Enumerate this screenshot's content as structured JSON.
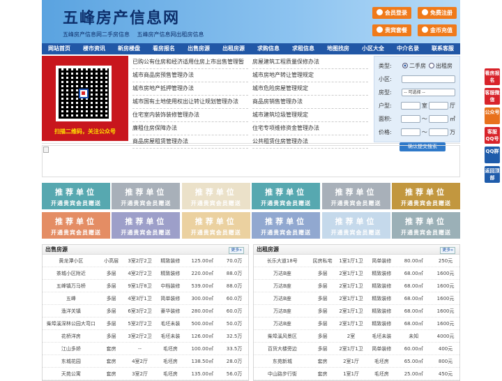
{
  "header": {
    "title": "五峰房产信息网",
    "links": [
      "五峰房产信息网二手房信息",
      "五峰房产信息网出租房信息"
    ],
    "buttons": [
      "会员登录",
      "免费注册",
      "贵宾套餐",
      "金币充值"
    ]
  },
  "nav": [
    "网站首页",
    "楼市资讯",
    "新房楼盘",
    "看房报名",
    "出售房源",
    "出租房源",
    "求购信息",
    "求租信息",
    "地图找房",
    "小区大全",
    "中介名录",
    "联系客服"
  ],
  "qr": {
    "caption": "扫描二维码，关注公众号"
  },
  "news": {
    "left": [
      "已购公有住房和经济适用住房上市出售管理暂",
      "城市商品房预售管理办法",
      "城市房地产抵押管理办法",
      "城市国有土地使用权出让转让规划管理办法",
      "住宅室内装饰装修管理办法",
      "廉租住房保障办法",
      "商品房屋租赁管理办法"
    ],
    "right": [
      "房屋建筑工程质量保修办法",
      "城市房地产转让管理规定",
      "城市危险房屋管理规定",
      "商品房销售管理办法",
      "城市建筑垃圾管理规定",
      "住宅专项维修资金管理办法",
      "公共租赁住房管理办法"
    ]
  },
  "search": {
    "type_label": "类型:",
    "opt1": "二手房",
    "opt2": "出租房",
    "community_label": "小区:",
    "house_label": "房型:",
    "house_value": "-- 可选择 --",
    "room_label": "户型:",
    "room_unit": "室",
    "hall_unit": "厅",
    "area_label": "面积:",
    "area_sep": "～",
    "area_unit": "㎡",
    "price_label": "价格:",
    "price_sep": "～",
    "price_unit": "万",
    "submit": "确认提交搜索"
  },
  "promo": {
    "t1": "推荐单位",
    "t2": "开通贵宾会员赠送",
    "colors": [
      "#3a9aa3",
      "#9aa3ad",
      "#e8dcc0",
      "#3a9aa3",
      "#9aa3ad",
      "#b8861e",
      "#e07a4a",
      "#8c8fc0",
      "#e8c990",
      "#7e99c8",
      "#bcd3e8",
      "#8aa3ab"
    ]
  },
  "sale": {
    "title": "出售房源",
    "more": "更多»",
    "rows": [
      [
        "黄龙潭小区",
        "小高层",
        "3室2厅2卫",
        "精致装修",
        "125.00㎡",
        "70.0万"
      ],
      [
        "茶城小区附近",
        "多层",
        "4室2厅2卫",
        "精致装修",
        "220.00㎡",
        "88.0万"
      ],
      [
        "五峰镇万马桥",
        "多层",
        "9室1厅8卫",
        "中档装修",
        "539.00㎡",
        "88.0万"
      ],
      [
        "五峰",
        "多层",
        "4室3厅1卫",
        "简单装修",
        "300.00㎡",
        "60.0万"
      ],
      [
        "渔洋关镇",
        "多层",
        "6室3厅2卫",
        "豪华装修",
        "280.00㎡",
        "60.0万"
      ],
      [
        "柴埠溪深林公园大弯口",
        "多层",
        "5室2厅2卫",
        "毛坯未装",
        "500.00㎡",
        "50.0万"
      ],
      [
        "花桥洋房",
        "多层",
        "3室2厅2卫",
        "毛坯未装",
        "126.00㎡",
        "32.5万"
      ],
      [
        "江山多娇",
        "套房",
        "--",
        "毛坯房",
        "100.00㎡",
        "33.5万"
      ],
      [
        "东城花园",
        "套房",
        "4室2厅",
        "毛坯房",
        "138.50㎡",
        "28.0万"
      ],
      [
        "天苑公寓",
        "套房",
        "3室2厅",
        "毛坯房",
        "135.00㎡",
        "56.0万"
      ]
    ]
  },
  "rent": {
    "title": "出租房源",
    "more": "更多»",
    "rows": [
      [
        "长乐大道18号",
        "民房私宅",
        "1室1厅1卫",
        "简单装修",
        "80.00㎡",
        "250元"
      ],
      [
        "万达B座",
        "多层",
        "2室1厅1卫",
        "精致装修",
        "68.00㎡",
        "1600元"
      ],
      [
        "万达B座",
        "多层",
        "2室1厅1卫",
        "精致装修",
        "68.00㎡",
        "1600元"
      ],
      [
        "万达B座",
        "多层",
        "2室1厅1卫",
        "精致装修",
        "68.00㎡",
        "1600元"
      ],
      [
        "万达B座",
        "多层",
        "2室1厅1卫",
        "精致装修",
        "68.00㎡",
        "1600元"
      ],
      [
        "万达B座",
        "多层",
        "2室1厅1卫",
        "精致装修",
        "68.00㎡",
        "1600元"
      ],
      [
        "柴埠溪风景区",
        "多层",
        "2室",
        "毛坯未装",
        "未知",
        "4000元"
      ],
      [
        "百货大楼旁边",
        "多层",
        "2室1厅1卫",
        "简单装修",
        "60.00㎡",
        "400元"
      ],
      [
        "东苑新城",
        "套房",
        "2室1厅",
        "毛坯房",
        "65.00㎡",
        "800元"
      ],
      [
        "中山路步行街",
        "套房",
        "1室1厅",
        "毛坯房",
        "25.00㎡",
        "450元"
      ]
    ]
  },
  "side": [
    {
      "label": "看房报名",
      "color": "#d8232a"
    },
    {
      "label": "客服微信",
      "color": "#d8232a"
    },
    {
      "label": "公众号",
      "color": "#e8711c"
    },
    {
      "label": "客服QQ号",
      "color": "#d8232a"
    },
    {
      "label": "QQ群",
      "color": "#1f5cab"
    },
    {
      "label": "返回顶部",
      "color": "#1f5cab"
    }
  ]
}
